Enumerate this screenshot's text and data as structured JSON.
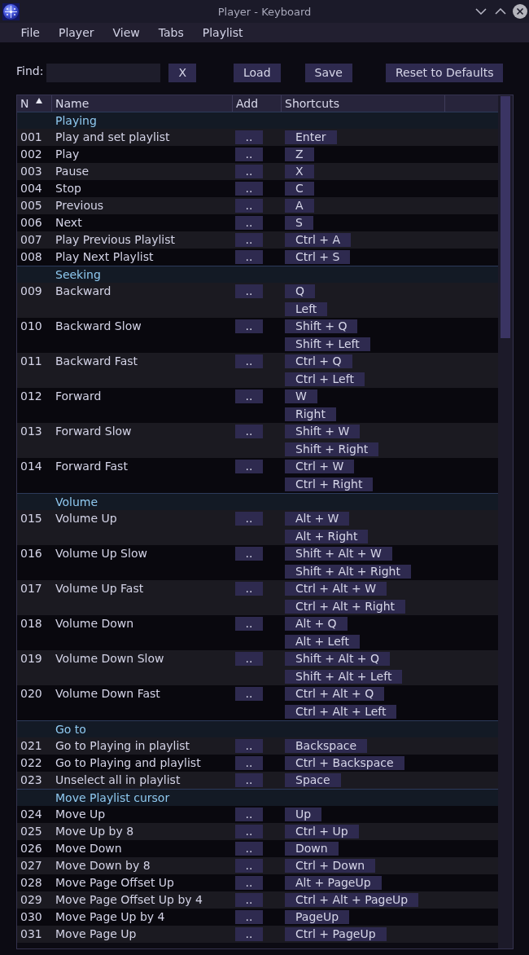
{
  "window": {
    "title": "Player - Keyboard"
  },
  "menu": [
    "File",
    "Player",
    "View",
    "Tabs",
    "Playlist"
  ],
  "find_bar": {
    "label": "Find:",
    "clear_button": "X",
    "buttons": [
      "Load",
      "Save",
      "Reset to Defaults"
    ]
  },
  "table": {
    "columns": [
      {
        "label": "N",
        "sorted": true
      },
      {
        "label": "Name",
        "sorted": false
      },
      {
        "label": "Add",
        "sorted": false
      },
      {
        "label": "Shortcuts",
        "sorted": false
      }
    ],
    "groups": [
      {
        "title": "Playing",
        "rows": [
          {
            "n": "001",
            "name": "Play and set playlist",
            "add": "..",
            "shortcuts": [
              "Enter"
            ]
          },
          {
            "n": "002",
            "name": "Play",
            "add": "..",
            "shortcuts": [
              "Z"
            ]
          },
          {
            "n": "003",
            "name": "Pause",
            "add": "..",
            "shortcuts": [
              "X"
            ]
          },
          {
            "n": "004",
            "name": "Stop",
            "add": "..",
            "shortcuts": [
              "C"
            ]
          },
          {
            "n": "005",
            "name": "Previous",
            "add": "..",
            "shortcuts": [
              "A"
            ]
          },
          {
            "n": "006",
            "name": "Next",
            "add": "..",
            "shortcuts": [
              "S"
            ]
          },
          {
            "n": "007",
            "name": "Play Previous Playlist",
            "add": "..",
            "shortcuts": [
              "Ctrl + A"
            ]
          },
          {
            "n": "008",
            "name": "Play Next Playlist",
            "add": "..",
            "shortcuts": [
              "Ctrl + S"
            ]
          }
        ]
      },
      {
        "title": "Seeking",
        "rows": [
          {
            "n": "009",
            "name": "Backward",
            "add": "..",
            "shortcuts": [
              "Q",
              "Left"
            ]
          },
          {
            "n": "010",
            "name": "Backward Slow",
            "add": "..",
            "shortcuts": [
              "Shift + Q",
              "Shift + Left"
            ]
          },
          {
            "n": "011",
            "name": "Backward Fast",
            "add": "..",
            "shortcuts": [
              "Ctrl + Q",
              "Ctrl + Left"
            ]
          },
          {
            "n": "012",
            "name": "Forward",
            "add": "..",
            "shortcuts": [
              "W",
              "Right"
            ]
          },
          {
            "n": "013",
            "name": "Forward Slow",
            "add": "..",
            "shortcuts": [
              "Shift + W",
              "Shift + Right"
            ]
          },
          {
            "n": "014",
            "name": "Forward Fast",
            "add": "..",
            "shortcuts": [
              "Ctrl + W",
              "Ctrl + Right"
            ]
          }
        ]
      },
      {
        "title": "Volume",
        "rows": [
          {
            "n": "015",
            "name": "Volume Up",
            "add": "..",
            "shortcuts": [
              "Alt + W",
              "Alt + Right"
            ]
          },
          {
            "n": "016",
            "name": "Volume Up Slow",
            "add": "..",
            "shortcuts": [
              "Shift + Alt + W",
              "Shift + Alt + Right"
            ]
          },
          {
            "n": "017",
            "name": "Volume Up Fast",
            "add": "..",
            "shortcuts": [
              "Ctrl + Alt + W",
              "Ctrl + Alt + Right"
            ]
          },
          {
            "n": "018",
            "name": "Volume Down",
            "add": "..",
            "shortcuts": [
              "Alt + Q",
              "Alt + Left"
            ]
          },
          {
            "n": "019",
            "name": "Volume Down Slow",
            "add": "..",
            "shortcuts": [
              "Shift + Alt + Q",
              "Shift + Alt + Left"
            ]
          },
          {
            "n": "020",
            "name": "Volume Down Fast",
            "add": "..",
            "shortcuts": [
              "Ctrl + Alt + Q",
              "Ctrl + Alt + Left"
            ]
          }
        ]
      },
      {
        "title": "Go to",
        "rows": [
          {
            "n": "021",
            "name": "Go to Playing in playlist",
            "add": "..",
            "shortcuts": [
              "Backspace"
            ]
          },
          {
            "n": "022",
            "name": "Go to Playing and playlist",
            "add": "..",
            "shortcuts": [
              "Ctrl + Backspace"
            ]
          },
          {
            "n": "023",
            "name": "Unselect all in playlist",
            "add": "..",
            "shortcuts": [
              "Space"
            ]
          }
        ]
      },
      {
        "title": "Move Playlist cursor",
        "rows": [
          {
            "n": "024",
            "name": "Move Up",
            "add": "..",
            "shortcuts": [
              "Up"
            ]
          },
          {
            "n": "025",
            "name": "Move Up by 8",
            "add": "..",
            "shortcuts": [
              "Ctrl + Up"
            ]
          },
          {
            "n": "026",
            "name": "Move Down",
            "add": "..",
            "shortcuts": [
              "Down"
            ]
          },
          {
            "n": "027",
            "name": "Move Down by 8",
            "add": "..",
            "shortcuts": [
              "Ctrl + Down"
            ]
          },
          {
            "n": "028",
            "name": "Move Page Offset Up",
            "add": "..",
            "shortcuts": [
              "Alt + PageUp"
            ]
          },
          {
            "n": "029",
            "name": "Move Page Offset Up by 4",
            "add": "..",
            "shortcuts": [
              "Ctrl + Alt + PageUp"
            ]
          },
          {
            "n": "030",
            "name": "Move Page Up by 4",
            "add": "..",
            "shortcuts": [
              "PageUp"
            ]
          },
          {
            "n": "031",
            "name": "Move Page Up",
            "add": "..",
            "shortcuts": [
              "Ctrl + PageUp"
            ]
          }
        ]
      }
    ]
  }
}
